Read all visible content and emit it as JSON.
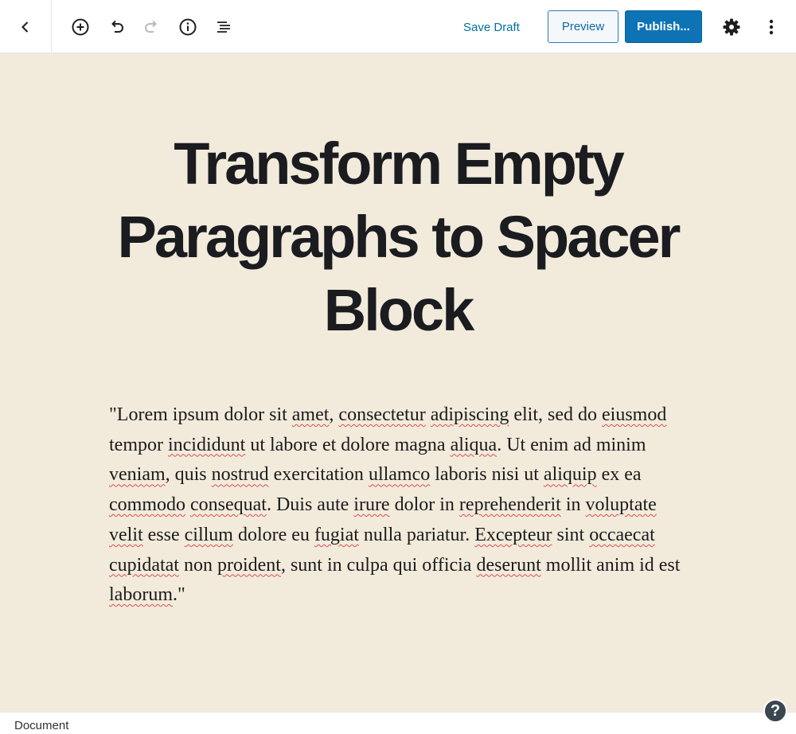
{
  "toolbar": {
    "back_icon": "chevron-left-icon",
    "add_block_icon": "plus-circle-icon",
    "undo_icon": "undo-icon",
    "redo_icon": "redo-icon",
    "info_icon": "info-icon",
    "outline_icon": "list-outline-icon",
    "save_draft_label": "Save Draft",
    "preview_label": "Preview",
    "publish_label": "Publish...",
    "settings_icon": "gear-icon",
    "more_icon": "vertical-ellipsis-icon"
  },
  "post": {
    "title": "Transform Empty Paragraphs to Spacer Block",
    "body_segments": [
      {
        "text": "\"Lorem ipsum dolor sit ",
        "spell": false
      },
      {
        "text": "amet",
        "spell": true
      },
      {
        "text": ", ",
        "spell": false
      },
      {
        "text": "consectetur",
        "spell": true
      },
      {
        "text": " ",
        "spell": false
      },
      {
        "text": "adipiscing",
        "spell": true
      },
      {
        "text": " elit, sed do ",
        "spell": false
      },
      {
        "text": "eiusmod",
        "spell": true
      },
      {
        "text": " tempor ",
        "spell": false
      },
      {
        "text": "incididunt",
        "spell": true
      },
      {
        "text": " ut labore et dolore magna ",
        "spell": false
      },
      {
        "text": "aliqua",
        "spell": true
      },
      {
        "text": ". Ut enim ad minim ",
        "spell": false
      },
      {
        "text": "veniam",
        "spell": true
      },
      {
        "text": ", quis ",
        "spell": false
      },
      {
        "text": "nostrud",
        "spell": true
      },
      {
        "text": " exercitation ",
        "spell": false
      },
      {
        "text": "ullamco",
        "spell": true
      },
      {
        "text": " laboris nisi ut ",
        "spell": false
      },
      {
        "text": "aliquip",
        "spell": true
      },
      {
        "text": " ex ea ",
        "spell": false
      },
      {
        "text": "commodo",
        "spell": true
      },
      {
        "text": " ",
        "spell": false
      },
      {
        "text": "consequat",
        "spell": true
      },
      {
        "text": ". Duis aute ",
        "spell": false
      },
      {
        "text": "irure",
        "spell": true
      },
      {
        "text": " dolor in ",
        "spell": false
      },
      {
        "text": "reprehenderit",
        "spell": true
      },
      {
        "text": " in ",
        "spell": false
      },
      {
        "text": "voluptate",
        "spell": true
      },
      {
        "text": " ",
        "spell": false
      },
      {
        "text": "velit",
        "spell": true
      },
      {
        "text": " esse ",
        "spell": false
      },
      {
        "text": "cillum",
        "spell": true
      },
      {
        "text": " dolore eu ",
        "spell": false
      },
      {
        "text": "fugiat",
        "spell": true
      },
      {
        "text": " nulla pariatur. ",
        "spell": false
      },
      {
        "text": "Excepteur",
        "spell": true
      },
      {
        "text": " sint ",
        "spell": false
      },
      {
        "text": "occaecat",
        "spell": true
      },
      {
        "text": " ",
        "spell": false
      },
      {
        "text": "cupidatat",
        "spell": true
      },
      {
        "text": " non ",
        "spell": false
      },
      {
        "text": "proident",
        "spell": true
      },
      {
        "text": ", sunt in culpa qui officia ",
        "spell": false
      },
      {
        "text": "deserunt",
        "spell": true
      },
      {
        "text": " mollit anim id est ",
        "spell": false
      },
      {
        "text": "laborum",
        "spell": true
      },
      {
        "text": ".\"",
        "spell": false
      }
    ]
  },
  "footer": {
    "breadcrumb_label": "Document",
    "help_label": "?",
    "help_icon": "help-icon"
  },
  "colors": {
    "canvas_background": "#f2ebdc",
    "accent": "#0e73b5",
    "spellcheck_underline": "#d94f4f"
  }
}
